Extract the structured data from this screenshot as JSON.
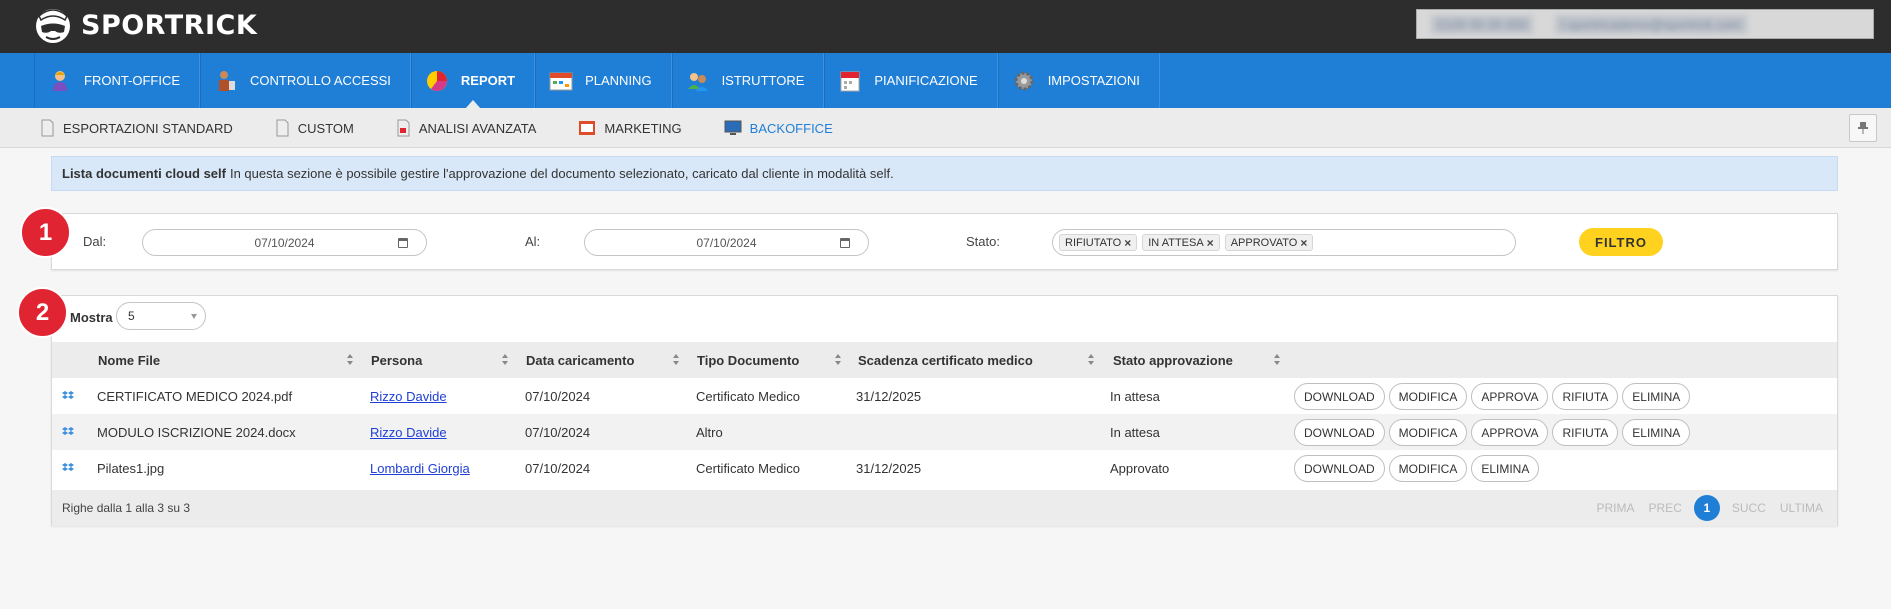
{
  "app": {
    "name": "SPORTRICK"
  },
  "user": {
    "session": "0100 00 00 000",
    "email": "l.sportricademo@sportrick.com"
  },
  "main_nav": [
    {
      "label": "FRONT-OFFICE",
      "icon": "person-icon",
      "active": false
    },
    {
      "label": "CONTROLLO ACCESSI",
      "icon": "access-control-icon",
      "active": false
    },
    {
      "label": "REPORT",
      "icon": "pie-chart-icon",
      "active": true
    },
    {
      "label": "PLANNING",
      "icon": "planning-icon",
      "active": false
    },
    {
      "label": "ISTRUTTORE",
      "icon": "instructor-icon",
      "active": false
    },
    {
      "label": "PIANIFICAZIONE",
      "icon": "calendar-icon",
      "active": false
    },
    {
      "label": "IMPOSTAZIONI",
      "icon": "gear-icon",
      "active": false
    }
  ],
  "sub_nav": [
    {
      "label": "ESPORTAZIONI STANDARD",
      "icon": "document-icon",
      "active": false
    },
    {
      "label": "CUSTOM",
      "icon": "document-icon",
      "active": false
    },
    {
      "label": "ANALISI AVANZATA",
      "icon": "report-doc-icon",
      "active": false
    },
    {
      "label": "MARKETING",
      "icon": "marketing-icon",
      "active": false
    },
    {
      "label": "BACKOFFICE",
      "icon": "monitor-icon",
      "active": true
    }
  ],
  "info": {
    "title": "Lista documenti cloud self",
    "text": "In questa sezione è possibile gestire l'approvazione del documento selezionato, caricato dal cliente in modalità self."
  },
  "steps": [
    "1",
    "2"
  ],
  "filter": {
    "dal_label": "Dal:",
    "dal_value": "07/10/2024",
    "al_label": "Al:",
    "al_value": "07/10/2024",
    "stato_label": "Stato:",
    "stato_tags": [
      "RIFIUTATO",
      "IN ATTESA",
      "APPROVATO"
    ],
    "button": "FILTRO"
  },
  "table": {
    "mostra_label": "Mostra",
    "mostra_value": "5",
    "columns": [
      "Nome File",
      "Persona",
      "Data caricamento",
      "Tipo Documento",
      "Scadenza certificato medico",
      "Stato approvazione"
    ],
    "rows": [
      {
        "file": "CERTIFICATO MEDICO 2024.pdf",
        "persona": "Rizzo Davide",
        "data": "07/10/2024",
        "tipo": "Certificato Medico",
        "scadenza": "31/12/2025",
        "stato": "In attesa",
        "actions": [
          "DOWNLOAD",
          "MODIFICA",
          "APPROVA",
          "RIFIUTA",
          "ELIMINA"
        ]
      },
      {
        "file": "MODULO ISCRIZIONE 2024.docx",
        "persona": "Rizzo Davide",
        "data": "07/10/2024",
        "tipo": "Altro",
        "scadenza": "",
        "stato": "In attesa",
        "actions": [
          "DOWNLOAD",
          "MODIFICA",
          "APPROVA",
          "RIFIUTA",
          "ELIMINA"
        ]
      },
      {
        "file": "Pilates1.jpg",
        "persona": "Lombardi Giorgia",
        "data": "07/10/2024",
        "tipo": "Certificato Medico",
        "scadenza": "31/12/2025",
        "stato": "Approvato",
        "actions": [
          "DOWNLOAD",
          "MODIFICA",
          "ELIMINA"
        ]
      }
    ],
    "footer_info": "Righe dalla 1 alla 3 su 3",
    "pager": {
      "first": "PRIMA",
      "prev": "PREC",
      "current": "1",
      "next": "SUCC",
      "last": "ULTIMA"
    }
  },
  "colors": {
    "topbar": "#2d2d2d",
    "nav_blue": "#1f7fd6",
    "accent_yellow": "#ffd21f",
    "step_red": "#e02432"
  }
}
